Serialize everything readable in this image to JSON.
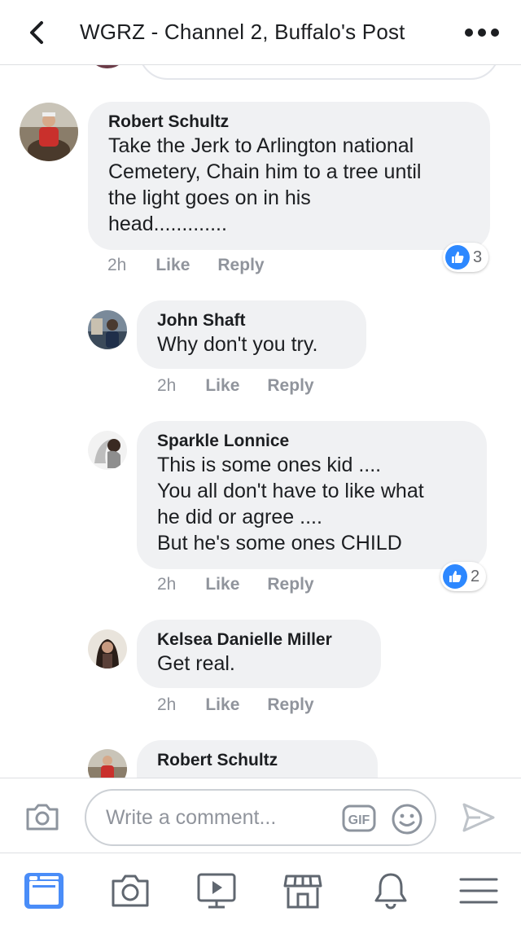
{
  "header": {
    "title": "WGRZ - Channel 2, Buffalo's Post",
    "back_icon": "chevron-left-icon",
    "more_icon": "more-horizontal-icon"
  },
  "comments": [
    {
      "name": "Robert Schultz",
      "text": "Take the Jerk to Arlington national\nCemetery, Chain him to a tree until\nthe light goes on in his\nhead.............",
      "time": "2h",
      "like": "Like",
      "reply": "Reply",
      "reactions": "3"
    },
    {
      "name": "John Shaft",
      "text": "Why don't you try.",
      "time": "2h",
      "like": "Like",
      "reply": "Reply"
    },
    {
      "name": "Sparkle Lonnice",
      "text": "This is some ones kid ....\nYou all don't have to like what\nhe did or agree ....\nBut he's some ones CHILD",
      "time": "2h",
      "like": "Like",
      "reply": "Reply",
      "reactions": "2"
    },
    {
      "name": "Kelsea Danielle Miller",
      "text": "Get real.",
      "time": "2h",
      "like": "Like",
      "reply": "Reply"
    },
    {
      "name": "Robert Schultz",
      "text": ""
    }
  ],
  "composer": {
    "placeholder": "Write a comment...",
    "gif_label": "GIF"
  },
  "tabbar": [
    "news-feed-icon",
    "camera-icon",
    "watch-video-icon",
    "marketplace-icon",
    "notifications-bell-icon",
    "menu-icon"
  ],
  "colors": {
    "accent": "#4267b2",
    "like_blue": "#2d88ff",
    "bubble": "#f0f1f3",
    "meta_gray": "#90949c"
  }
}
